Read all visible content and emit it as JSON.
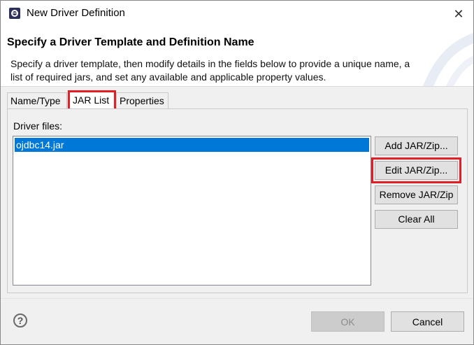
{
  "window": {
    "title": "New Driver Definition",
    "close_glyph": "✕"
  },
  "header": {
    "title": "Specify a Driver Template and Definition Name",
    "description": "Specify a driver template, then modify details in the fields below to provide a unique name, a list of required jars, and set any available and applicable property values."
  },
  "tabs": [
    {
      "label": "Name/Type",
      "active": false
    },
    {
      "label": "JAR List",
      "active": true
    },
    {
      "label": "Properties",
      "active": false
    }
  ],
  "panel": {
    "label": "Driver files:",
    "files": [
      "ojdbc14.jar"
    ],
    "selected_file": "ojdbc14.jar"
  },
  "buttons": {
    "add": "Add JAR/Zip...",
    "edit": "Edit JAR/Zip...",
    "remove": "Remove JAR/Zip",
    "clear": "Clear All"
  },
  "footer": {
    "help_glyph": "?",
    "ok": "OK",
    "cancel": "Cancel"
  },
  "colors": {
    "selection": "#0078d7",
    "highlight": "#e01f26"
  }
}
